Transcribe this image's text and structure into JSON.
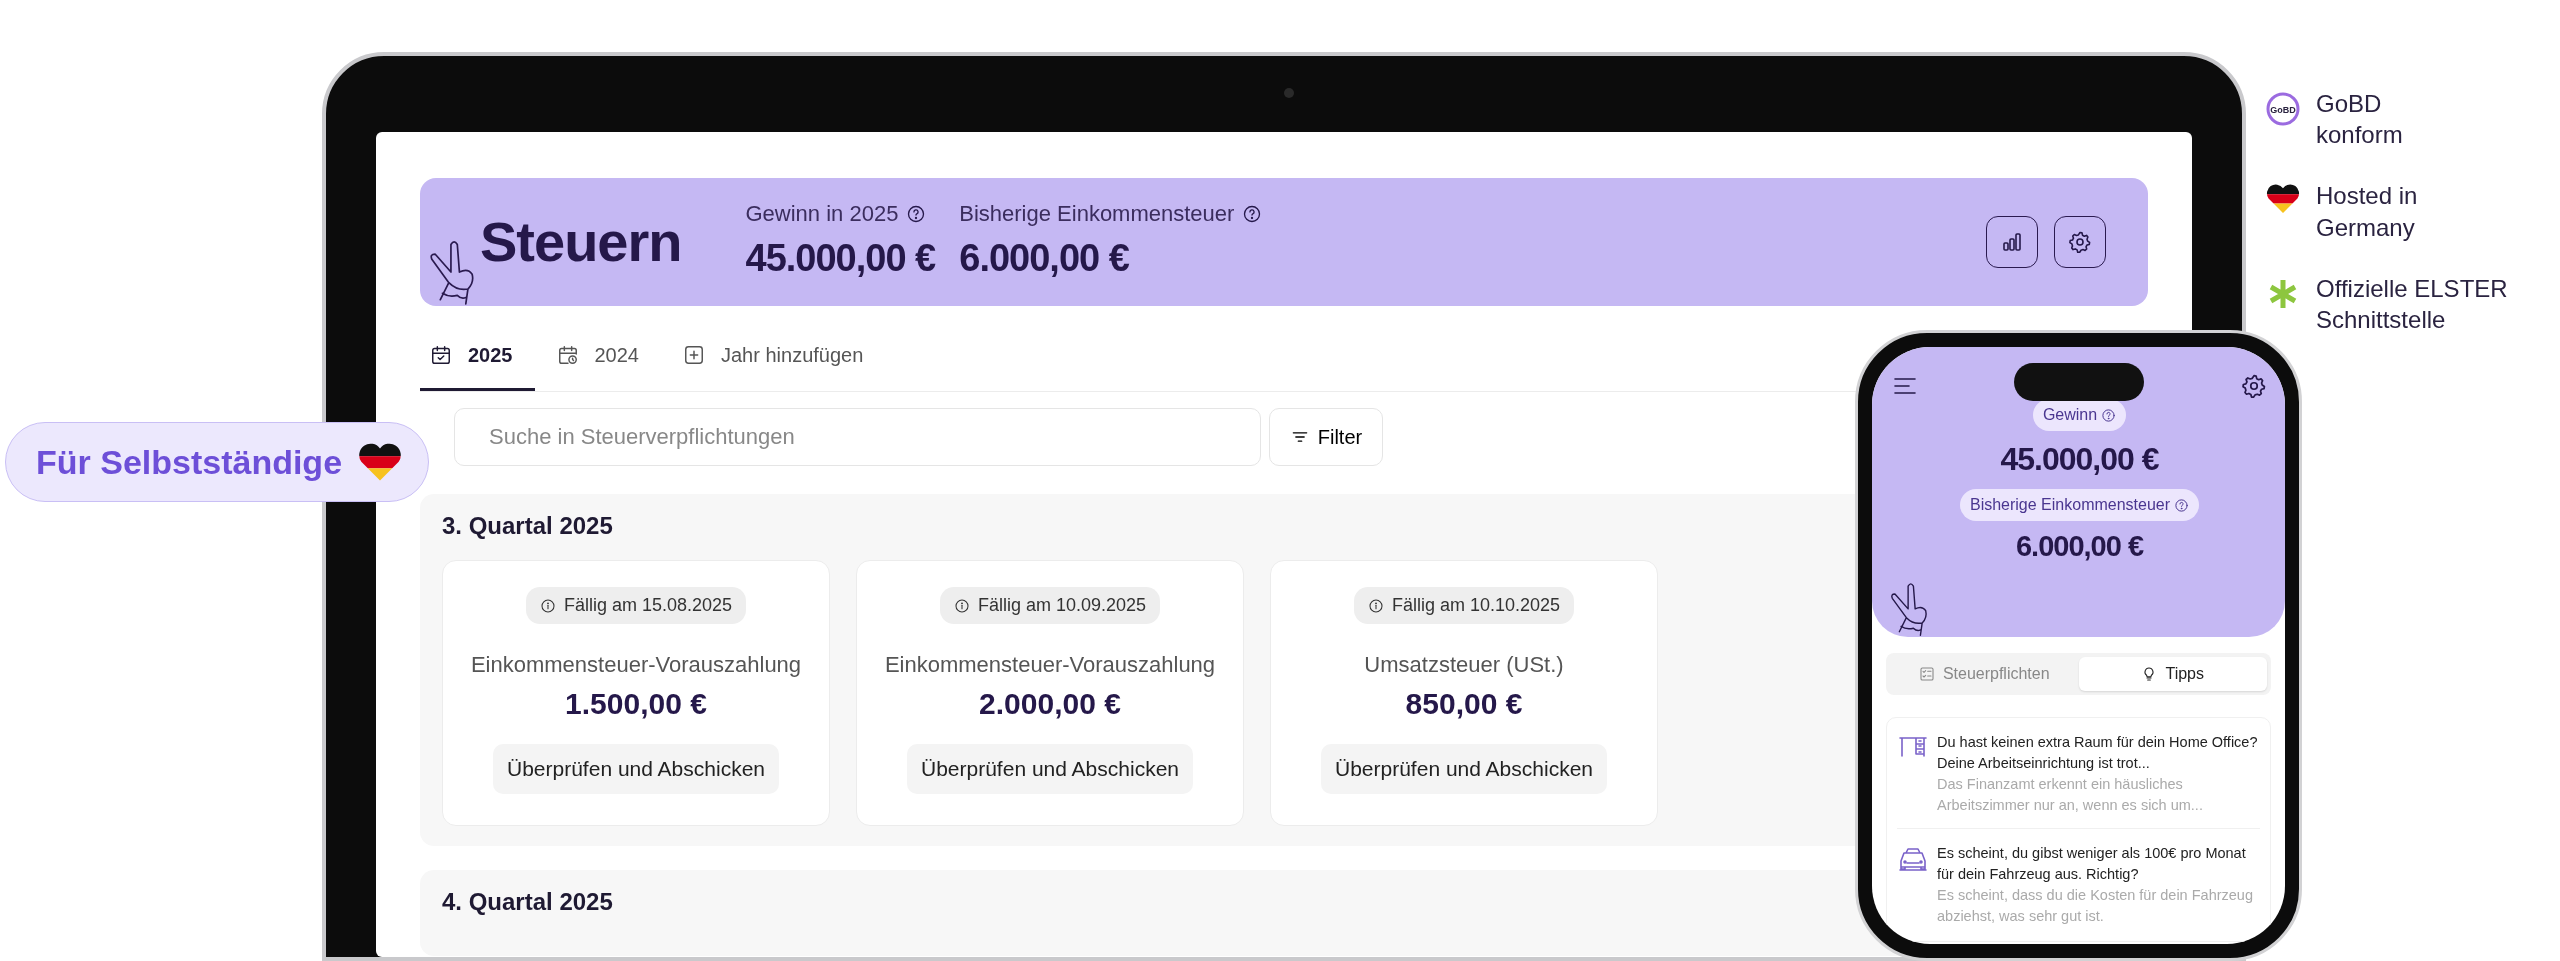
{
  "side_badge": {
    "label": "Für Selbstständige"
  },
  "laptop_screen": {
    "title": "Steuern",
    "stats": [
      {
        "label": "Gewinn in 2025",
        "value": "45.000,00 €"
      },
      {
        "label": "Bisherige Einkommensteuer",
        "value": "6.000,00 €"
      }
    ],
    "tabs": [
      {
        "label": "2025",
        "selected": true,
        "kind": "calendar-check"
      },
      {
        "label": "2024",
        "selected": false,
        "kind": "calendar-clock"
      },
      {
        "label": "Jahr hinzufügen",
        "selected": false,
        "kind": "add"
      }
    ],
    "search": {
      "placeholder": "Suche in Steuerverpflichtungen"
    },
    "filter_button": "Filter",
    "quarters": [
      {
        "title": "3. Quartal 2025",
        "items": [
          {
            "due": "Fällig am 15.08.2025",
            "name": "Einkommensteuer-Vorauszahlung",
            "amount": "1.500,00 €",
            "action": "Überprüfen und Abschicken"
          },
          {
            "due": "Fällig am 10.09.2025",
            "name": "Einkommensteuer-Vorauszahlung",
            "amount": "2.000,00 €",
            "action": "Überprüfen und Abschicken"
          },
          {
            "due": "Fällig am 10.10.2025",
            "name": "Umsatzsteuer (USt.)",
            "amount": "850,00 €",
            "action": "Überprüfen und Abschicken"
          }
        ]
      },
      {
        "title": "4. Quartal 2025"
      }
    ]
  },
  "phone_screen": {
    "stats": [
      {
        "label": "Gewinn",
        "value": "45.000,00 €"
      },
      {
        "label": "Bisherige Einkommensteuer",
        "value": "6.000,00 €"
      }
    ],
    "tabs": [
      {
        "label": "Steuerpflichten",
        "selected": false,
        "kind": "checklist"
      },
      {
        "label": "Tipps",
        "selected": true,
        "kind": "bulb"
      }
    ],
    "tips": [
      {
        "kind": "desk",
        "title": "Du hast keinen extra Raum für dein Home Office? Deine Arbeitseinrichtung ist trot...",
        "text": "Das Finanzamt erkennt ein häusliches Arbeitszimmer nur an, wenn es sich um..."
      },
      {
        "kind": "car",
        "title": "Es scheint, du gibst weniger als 100€ pro Monat für dein Fahrzeug aus. Richtig?",
        "text": "Es scheint, dass du die Kosten für dein Fahrzeug abziehst, was sehr gut ist."
      }
    ]
  },
  "features": [
    {
      "kind": "gobd",
      "badge_text": "GoBD",
      "lines": [
        "GoBD",
        "konform"
      ]
    },
    {
      "kind": "heart",
      "lines": [
        "Hosted in",
        "Germany"
      ]
    },
    {
      "kind": "asterisk",
      "lines": [
        "Offizielle ELSTER",
        "Schnittstelle"
      ]
    }
  ]
}
